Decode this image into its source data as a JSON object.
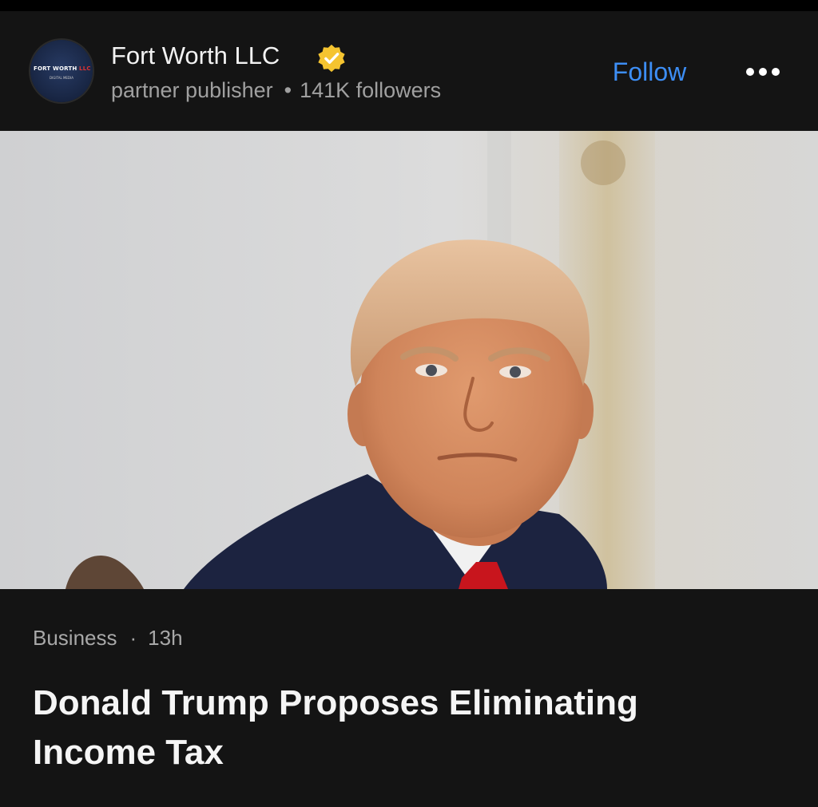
{
  "publisher": {
    "avatar_text_main": "FORT WORTH",
    "avatar_text_accent": "LLC",
    "avatar_text_sub": "DIGITAL MEDIA",
    "name": "Fort Worth LLC",
    "type": "partner publisher",
    "separator": "•",
    "followers": "141K followers",
    "verified_icon": "verified-badge-icon",
    "verified_color": "#f5c430"
  },
  "actions": {
    "follow_label": "Follow",
    "follow_color": "#3d8ef5",
    "more_icon": "more-dots-icon"
  },
  "article": {
    "category": "Business",
    "separator": "·",
    "time_ago": "13h",
    "headline": "Donald Trump Proposes Eliminating Income Tax",
    "image_subject": "photo-portrait"
  },
  "colors": {
    "background": "#141414",
    "text_primary": "#f5f5f5",
    "text_secondary": "#a0a0a0"
  }
}
